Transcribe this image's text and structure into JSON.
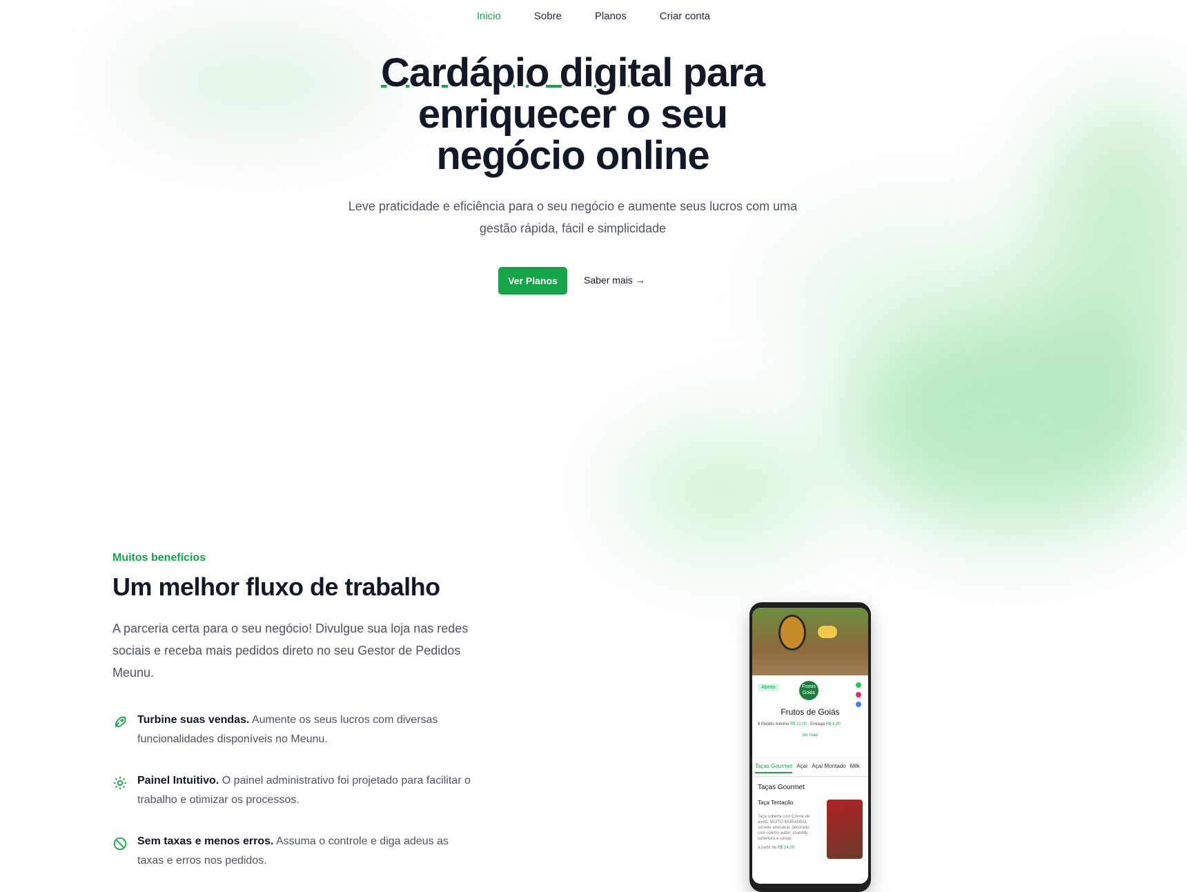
{
  "nav": {
    "items": [
      {
        "label": "Inicio",
        "active": true
      },
      {
        "label": "Sobre",
        "active": false
      },
      {
        "label": "Planos",
        "active": false
      },
      {
        "label": "Criar conta",
        "active": false
      }
    ]
  },
  "hero": {
    "title_highlight": "Cardápio digital",
    "title_line1_rest": "para",
    "title_line2": "enriquecer o seu",
    "title_line3": "negócio online",
    "subtitle": "Leve praticidade e eficiência para o seu negócio e aumente seus lucros com uma gestão rápida, fácil e simplicidade",
    "primary_button": "Ver Planos",
    "secondary_link": "Saber mais →"
  },
  "benefits": {
    "eyebrow": "Muitos benefícios",
    "title": "Um melhor fluxo de trabalho",
    "description": "A parceria certa para o seu negócio! Divulgue sua loja nas redes sociais e receba mais pedidos direto no seu Gestor de Pedidos Meunu.",
    "features": [
      {
        "icon": "rocket-icon",
        "title": "Turbine suas vendas.",
        "text": "Aumente os seus lucros com diversas funcionalidades disponíveis no Meunu."
      },
      {
        "icon": "gear-icon",
        "title": "Painel Intuitivo.",
        "text": "O painel administrativo foi projetado para facilitar o trabalho e otimizar os processos."
      },
      {
        "icon": "prohibited-icon",
        "title": "Sem taxas e menos erros.",
        "text": "Assuma o controle e diga adeus as taxas e erros nos pedidos."
      }
    ]
  },
  "phone": {
    "open_badge": "Aberto",
    "logo_text": "Frutos Goiás",
    "store_name": "Frutos de Goiás",
    "min_order_label": "Pedido mínimo",
    "min_order_value": "R$ 10,00",
    "delivery_label": "Entrega",
    "delivery_value": "R$ 5,00",
    "see_more": "Ver mais",
    "tabs": [
      "Taças Gourmet",
      "Açaí",
      "Açaí Montado",
      "Milk"
    ],
    "category": "Taças Gourmet",
    "item_name": "Taça Tentação",
    "item_desc": "Taça coberta com Creme de avelã, MUITO MORANGO, sorvete artesanal, decorada com rolinho wafer, chantilly, cobertura e cereja.",
    "item_price_prefix": "a partir de",
    "item_price": "R$ 24,00"
  },
  "colors": {
    "accent": "#16a34a",
    "text": "#111827",
    "muted": "#4b5563"
  }
}
